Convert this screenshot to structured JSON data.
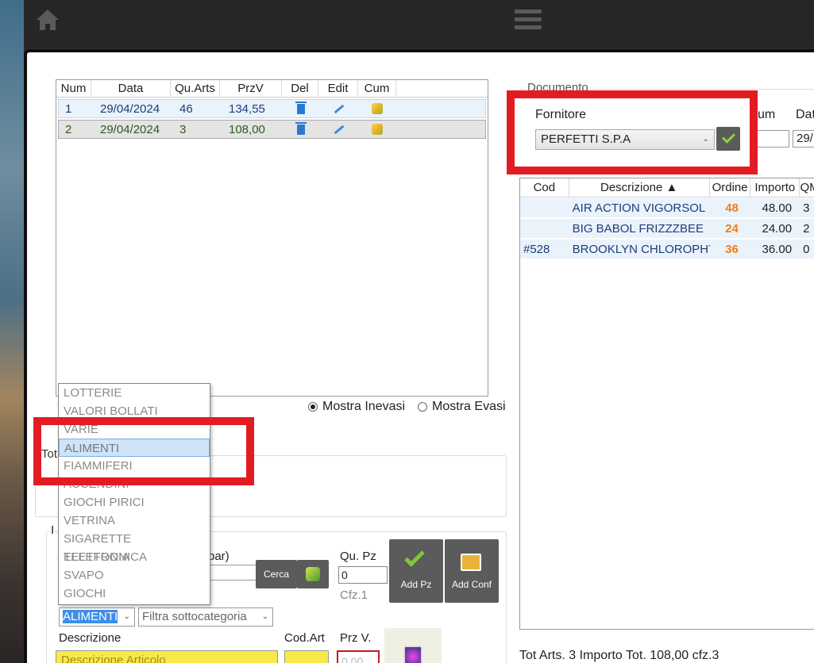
{
  "orders": {
    "headers": [
      "Num",
      "Data",
      "Qu.Arts",
      "PrzV",
      "Del",
      "Edit",
      "Cum"
    ],
    "rows": [
      {
        "num": "1",
        "data": "29/04/2024",
        "quarts": "46",
        "przv": "134,55"
      },
      {
        "num": "2",
        "data": "29/04/2024",
        "quarts": "3",
        "przv": "108,00"
      }
    ]
  },
  "filter": {
    "mostra_inevasi": "Mostra Inevasi",
    "mostra_evasi": "Mostra Evasi"
  },
  "tot_label": "Tot",
  "ins_label": "I",
  "barcode_label": "bar)",
  "cerca_label": "Cerca",
  "qupz_label": "Qu. Pz",
  "qupz_value": "0",
  "cfz_text": "Cfz.1",
  "add_pz_label": "Add Pz",
  "add_conf_label": "Add Conf",
  "category": {
    "selected": "ALIMENTI",
    "options": [
      "LOTTERIE",
      "VALORI BOLLATI",
      "VARIE",
      "ALIMENTI",
      "FIAMMIFERI",
      "ACCENDINI",
      "GIOCHI PIRICI",
      "VETRINA",
      "SIGARETTE ELETTRONICA",
      "TELEFONIA",
      "SVAPO",
      "GIOCHI"
    ]
  },
  "subcategory_placeholder": "Filtra sottocategoria",
  "descrizione_label": "Descrizione",
  "codart_label": "Cod.Art",
  "przv_label": "Prz V.",
  "descrizione_placeholder": "Descrizione Articolo",
  "przv_value": "0,00",
  "documento": {
    "label": "Documento",
    "fornitore_label": "Fornitore",
    "fornitore_value": "PERFETTI S.P.A",
    "num_label": "um",
    "data_label": "Dat",
    "data_value": "29/"
  },
  "items": {
    "headers": [
      "Cod",
      "Descrizione ▲",
      "Ordine",
      "Importo",
      "QM"
    ],
    "rows": [
      {
        "cod": "",
        "descrizione": "AIR ACTION VIGORSOL",
        "ordine": "48",
        "importo": "48.00",
        "qm": "3"
      },
      {
        "cod": "",
        "descrizione": "BIG BABOL FRIZZZBEE",
        "ordine": "24",
        "importo": "24.00",
        "qm": "2"
      },
      {
        "cod": "#528",
        "descrizione": "BROOKLYN CHLOROPHYLL",
        "ordine": "36",
        "importo": "36.00",
        "qm": "0"
      }
    ]
  },
  "footer": "Tot Arts. 3  Importo Tot. 108,00 cfz.3",
  "colors": {
    "accent_orange": "#ef7d13",
    "highlight_red": "#e21c22",
    "button_gray": "#5b5b5b",
    "input_yellow": "#f8e94a"
  }
}
